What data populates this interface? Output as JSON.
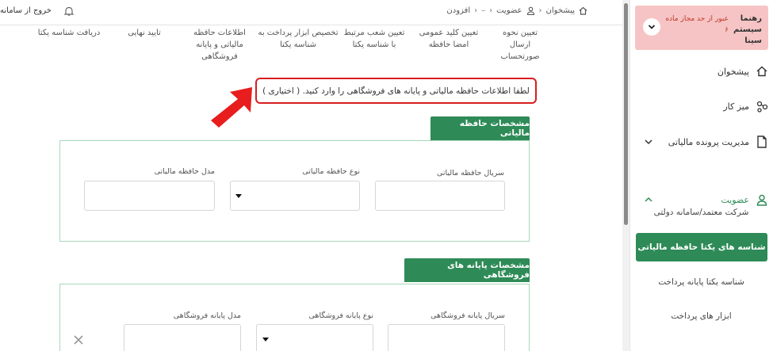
{
  "topbar": {
    "logout_label": "خروج از سامانه",
    "breadcrumb": [
      "پیشخوان",
      "عضویت",
      "افزودن"
    ],
    "breadcrumb_separator": "›",
    "breadcrumb_dash": "–"
  },
  "user": {
    "name": "رهنما سیستم سینا",
    "status": "عبور از حد مجاز ماده ۶"
  },
  "sidebar": {
    "items": [
      {
        "label": "پیشخوان",
        "icon": "home-icon"
      },
      {
        "label": "میز کار",
        "icon": "workflow-icon"
      },
      {
        "label": "مدیریت پرونده مالیاتی",
        "icon": "document-icon"
      },
      {
        "label": "عضویت",
        "icon": "user-icon"
      }
    ],
    "sub_items": [
      "شرکت معتمد/سامانه دولتی",
      "شناسه های یکتا حافظه مالیاتی",
      "شناسه یکتا پایانه پرداخت",
      "ابزار های پرداخت"
    ]
  },
  "steps": [
    "تعیین نحوه ارسال صورتحساب",
    "تعیین کلید عمومی امضا حافظه",
    "تعیین شعب مرتبط با شناسه یکتا",
    "تخصیص ابزار پرداخت به شناسه یکتا",
    "اطلاعات حافظه مالیاتی و پایانه فروشگاهی",
    "تایید نهایی",
    "دریافت شناسه یکتا"
  ],
  "instruction": "لطفا اطلاعات حافظه مالیاتی و پایانه های فروشگاهی را وارد کنید. ( اختیاری )",
  "sections": {
    "memory": {
      "title": "مشخصات حافظه مالیاتی",
      "serial_label": "سریال حافظه مالیاتی",
      "type_label": "نوع حافظه مالیاتی",
      "model_label": "مدل حافظه مالیاتی"
    },
    "terminal": {
      "title": "مشخصات پایانه های فروشگاهی",
      "serial_label": "سریال پایانه فروشگاهی",
      "type_label": "نوع پایانه فروشگاهی",
      "model_label": "مدل پایانه فروشگاهی"
    }
  },
  "colors": {
    "accent": "#2e8b57",
    "alert_bg": "#f6c4c4",
    "highlight_border": "#d81e1e"
  }
}
